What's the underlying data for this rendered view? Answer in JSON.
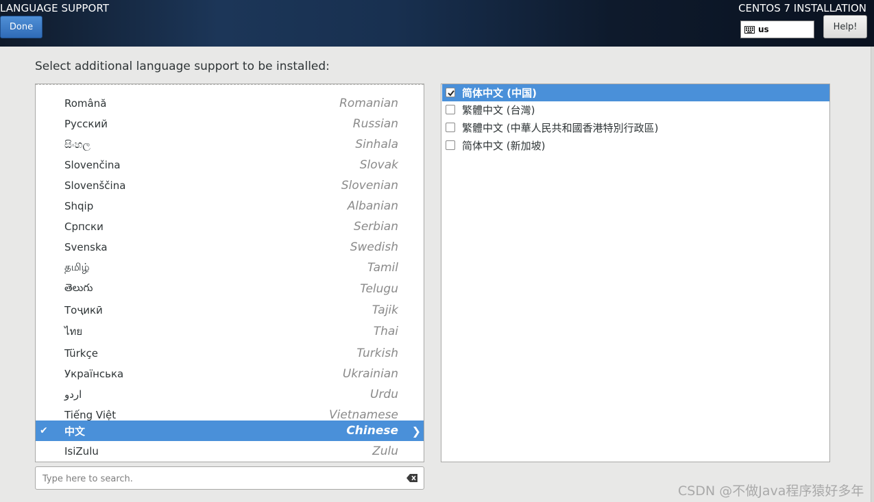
{
  "header": {
    "title": "LANGUAGE SUPPORT",
    "done_label": "Done",
    "install_title": "CENTOS 7 INSTALLATION",
    "keyboard_layout": "us",
    "help_label": "Help!"
  },
  "prompt": "Select additional language support to be installed:",
  "languages": [
    {
      "native": "Română",
      "english": "Romanian"
    },
    {
      "native": "Русский",
      "english": "Russian"
    },
    {
      "native": "සිංහල",
      "english": "Sinhala"
    },
    {
      "native": "Slovenčina",
      "english": "Slovak"
    },
    {
      "native": "Slovenščina",
      "english": "Slovenian"
    },
    {
      "native": "Shqip",
      "english": "Albanian"
    },
    {
      "native": "Српски",
      "english": "Serbian"
    },
    {
      "native": "Svenska",
      "english": "Swedish"
    },
    {
      "native": "தமிழ்",
      "english": "Tamil"
    },
    {
      "native": "తెలుగు",
      "english": "Telugu"
    },
    {
      "native": "Тоҷикӣ",
      "english": "Tajik"
    },
    {
      "native": "ไทย",
      "english": "Thai"
    },
    {
      "native": "Türkçe",
      "english": "Turkish"
    },
    {
      "native": "Українська",
      "english": "Ukrainian"
    },
    {
      "native": "اردو",
      "english": "Urdu"
    },
    {
      "native": "Tiếng Việt",
      "english": "Vietnamese"
    },
    {
      "native": "中文",
      "english": "Chinese",
      "selected": true
    },
    {
      "native": "IsiZulu",
      "english": "Zulu"
    }
  ],
  "search": {
    "placeholder": "Type here to search."
  },
  "locales": [
    {
      "label": "简体中文 (中国)",
      "checked": true,
      "selected": true
    },
    {
      "label": "繁體中文 (台灣)",
      "checked": false
    },
    {
      "label": "繁體中文 (中華人民共和國香港特別行政區)",
      "checked": false
    },
    {
      "label": "简体中文 (新加坡)",
      "checked": false
    }
  ],
  "watermark": "CSDN @不做Java程序猿好多年",
  "colors": {
    "selection": "#4a90d9",
    "header_bg": "#142640"
  }
}
